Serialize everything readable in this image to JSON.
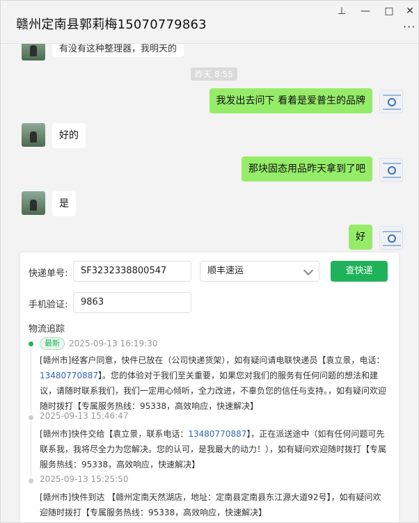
{
  "window": {
    "title": "赣州定南县郭莉梅15070779863",
    "pin_glyph": "⊥",
    "minimize_glyph": "—",
    "maximize_glyph": "□",
    "close_glyph": "✕",
    "more_glyph": "···"
  },
  "chat": {
    "cut_message": "有没有这种整理器，我明天的",
    "time_pill": "昨天 8:55",
    "messages": [
      {
        "side": "out",
        "text": "我发出去问下 看着是爱普生的品牌"
      },
      {
        "side": "in",
        "text": "好的"
      },
      {
        "side": "out",
        "text": "那块固态用品昨天拿到了吧"
      },
      {
        "side": "in",
        "text": "是"
      },
      {
        "side": "out",
        "text": "好"
      }
    ]
  },
  "express": {
    "tracking_label": "快递单号:",
    "tracking_value": "SF3232338800547",
    "carrier_value": "顺丰速运",
    "query_button": "查快递",
    "verify_label": "手机验证:",
    "verify_value": "9863",
    "section_title": "物流追踪",
    "events": [
      {
        "tag": "最新",
        "time": "2025-09-13 16:19:30",
        "body_pre": "[赣州市]经客户同意，快件已放在（公司快递货架），如有疑问请电联快递员【袁立景，电话：",
        "phone": "13480770887",
        "body_post": "】。您的体验对于我们至关重要，如果您对我们的服务有任何问题的想法和建议，请随时联系我们，我们一定用心倾听，全力改进，不辜负您的信任与支持。，如有疑问欢迎随时拨打【专属服务热线：95338，高效响应，快速解决】"
      },
      {
        "tag": "",
        "time": "2025-09-13 15:46:47",
        "body_pre": "[赣州市]快件交给【袁立景，联系电话：",
        "phone": "13480770887",
        "body_post": "】，正在派送途中（如有任何问题可先联系我，我将尽全力为您解决。您的认可，是我最大的动力！），如有疑问欢迎随时拨打【专属服务热线：95338，高效响应，快速解决】"
      },
      {
        "tag": "",
        "time": "2025-09-13 15:25:50",
        "body_pre": "[赣州市]快件到达 【赣州定南天然湖店，地址：定南县定南县东江源大道92号】，如有疑问欢迎随时拨打【专属服务热线：95338，高效响应，快速解决】",
        "phone": "",
        "body_post": ""
      }
    ]
  }
}
